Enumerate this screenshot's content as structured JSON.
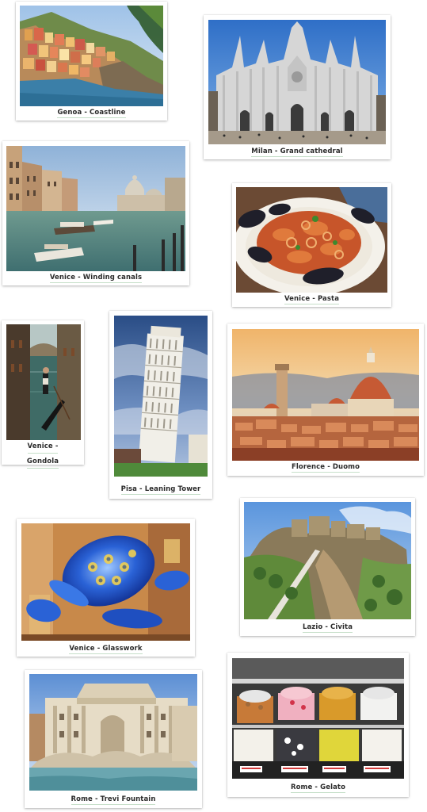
{
  "cards": [
    {
      "id": "genoa",
      "caption": "Genoa - Coastline"
    },
    {
      "id": "milan",
      "caption": "Milan - Grand cathedral"
    },
    {
      "id": "venice-canals",
      "caption": "Venice - Winding canals"
    },
    {
      "id": "venice-pasta",
      "caption": "Venice - Pasta"
    },
    {
      "id": "venice-gondola",
      "caption_line1": "Venice -",
      "caption_line2": "Gondola"
    },
    {
      "id": "pisa",
      "caption": "Pisa - Leaning Tower"
    },
    {
      "id": "florence",
      "caption": "Florence - Duomo"
    },
    {
      "id": "venice-glass",
      "caption": "Venice - Glasswork"
    },
    {
      "id": "lazio",
      "caption": "Lazio - Civita"
    },
    {
      "id": "rome-trevi",
      "caption": "Rome - Trevi Fountain"
    },
    {
      "id": "rome-gelato",
      "caption": "Rome - Gelato"
    }
  ]
}
